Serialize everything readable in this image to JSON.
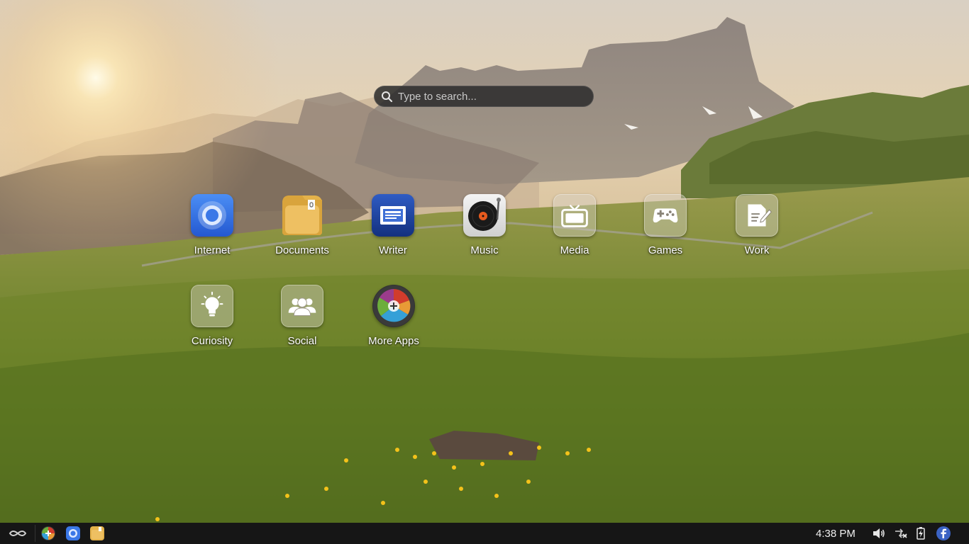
{
  "search": {
    "placeholder": "Type to search..."
  },
  "apps": [
    {
      "label": "Internet",
      "icon": "chromium-icon"
    },
    {
      "label": "Documents",
      "icon": "folder-icon"
    },
    {
      "label": "Writer",
      "icon": "writer-icon"
    },
    {
      "label": "Music",
      "icon": "turntable-icon"
    },
    {
      "label": "Media",
      "icon": "tv-icon"
    },
    {
      "label": "Games",
      "icon": "gamepad-icon"
    },
    {
      "label": "Work",
      "icon": "document-pen-icon"
    },
    {
      "label": "Curiosity",
      "icon": "lightbulb-icon"
    },
    {
      "label": "Social",
      "icon": "people-icon"
    },
    {
      "label": "More Apps",
      "icon": "app-store-icon"
    }
  ],
  "taskbar": {
    "clock": "4:38 PM",
    "left_icons": [
      "endless-logo-icon",
      "app-center-icon",
      "chromium-icon",
      "files-icon"
    ],
    "tray_icons": [
      "volume-icon",
      "network-disconnected-icon",
      "battery-charging-icon",
      "facebook-icon"
    ]
  },
  "colors": {
    "taskbar": "#161616",
    "label_text": "#ffffff",
    "search_bg": "#2d2d2d"
  }
}
